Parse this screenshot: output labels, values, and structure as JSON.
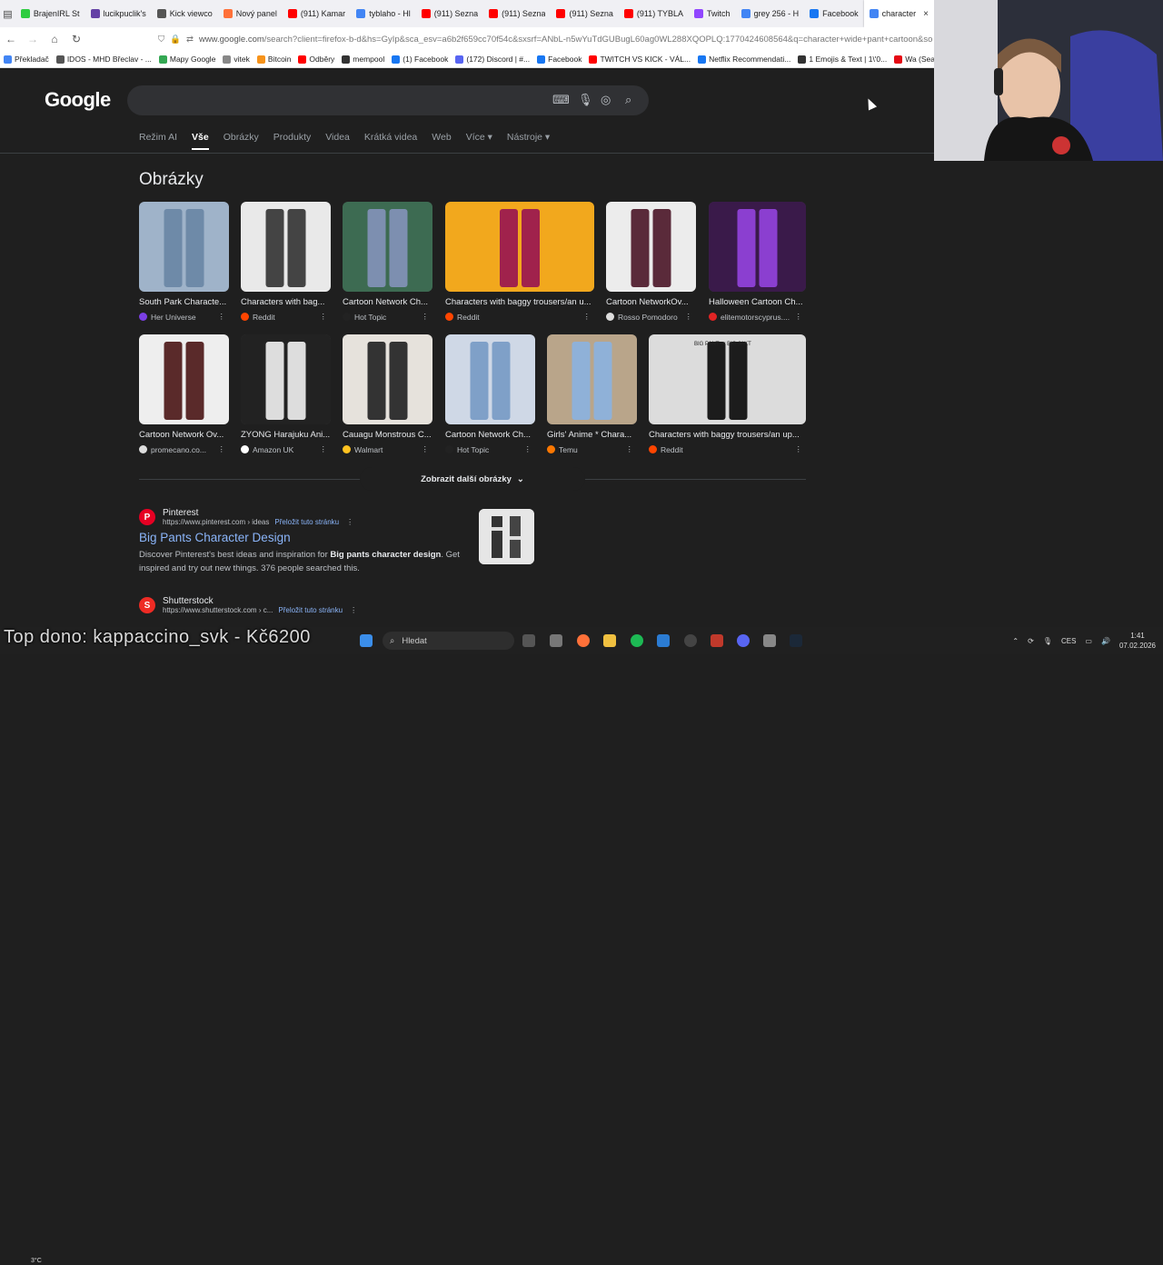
{
  "browser": {
    "tabs": [
      {
        "label": "BrajenIRL St",
        "color": "#2ecc40"
      },
      {
        "label": "lucikpuclik's",
        "color": "#6441a5"
      },
      {
        "label": "Kick viewco",
        "color": "#555555"
      },
      {
        "label": "Nový panel",
        "color": "#ff7139"
      },
      {
        "label": "(911) Kamar",
        "color": "#ff0000"
      },
      {
        "label": "tyblaho - Hl",
        "color": "#4285f4"
      },
      {
        "label": "(911) Sezna",
        "color": "#ff0000"
      },
      {
        "label": "(911) Sezna",
        "color": "#ff0000"
      },
      {
        "label": "(911) Sezna",
        "color": "#ff0000"
      },
      {
        "label": "(911) TYBLA",
        "color": "#ff0000"
      },
      {
        "label": "Twitch",
        "color": "#9146ff"
      },
      {
        "label": "grey 256 - H",
        "color": "#4285f4"
      },
      {
        "label": "Facebook",
        "color": "#1877f2"
      },
      {
        "label": "character",
        "color": "#4285f4",
        "active": true
      }
    ],
    "url_host": "www.google.com",
    "url_rest": "/search?client=firefox-b-d&hs=GyIp&sca_esv=a6b2f659cc70f54c&sxsrf=ANbL-n5wYuTdGUBugL60ag0WL288XQOPLQ:1770424608564&q=character+wide+pant+cartoon&so",
    "bookmarks": [
      {
        "label": "Překladač",
        "color": "#4285f4"
      },
      {
        "label": "IDOS - MHD Břeclav - ...",
        "color": "#555555"
      },
      {
        "label": "Mapy Google",
        "color": "#34a853"
      },
      {
        "label": "vitek",
        "color": "#888888"
      },
      {
        "label": "Bitcoin",
        "color": "#f7931a"
      },
      {
        "label": "Odběry",
        "color": "#ff0000"
      },
      {
        "label": "mempool",
        "color": "#333333"
      },
      {
        "label": "(1) Facebook",
        "color": "#1877f2"
      },
      {
        "label": "(172) Discord | #...",
        "color": "#5865f2"
      },
      {
        "label": "Facebook",
        "color": "#1877f2"
      },
      {
        "label": "TWITCH VS KICK - VÁL...",
        "color": "#ff0000"
      },
      {
        "label": "Netflix Recommendati...",
        "color": "#1877f2"
      },
      {
        "label": "1 Emojis & Text | 1\\'0...",
        "color": "#333333"
      },
      {
        "label": "Wa (Seaso",
        "color": "#e50914"
      }
    ]
  },
  "google": {
    "logo": "Google",
    "tabs": [
      "Režim AI",
      "Vše",
      "Obrázky",
      "Produkty",
      "Videa",
      "Krátká videa",
      "Web",
      "Více ▾",
      "Nástroje ▾"
    ],
    "section_title": "Obrázky",
    "images": [
      {
        "title": "South Park Characte...",
        "source": "Her Universe",
        "src_color": "#7b3fe4"
      },
      {
        "title": "Characters with bag...",
        "source": "Reddit",
        "src_color": "#ff4500"
      },
      {
        "title": "Cartoon Network Ch...",
        "source": "Hot Topic",
        "src_color": "#222222"
      },
      {
        "title": "Characters with baggy trousers/an u...",
        "source": "Reddit",
        "src_color": "#ff4500"
      },
      {
        "title": "Cartoon NetworkOv...",
        "source": "Rosso Pomodoro",
        "src_color": "#dddddd"
      },
      {
        "title": "Halloween Cartoon Ch...",
        "source": "elitemotorscyprus....",
        "src_color": "#e02424"
      },
      {
        "title": "Cartoon Network Ov...",
        "source": "promecano.co...",
        "src_color": "#dddddd"
      },
      {
        "title": "ZYONG Harajuku Ani...",
        "source": "Amazon UK",
        "src_color": "#ffffff"
      },
      {
        "title": "Cauagu Monstrous C...",
        "source": "Walmart",
        "src_color": "#ffc220"
      },
      {
        "title": "Cartoon Network Ch...",
        "source": "Hot Topic",
        "src_color": "#222222"
      },
      {
        "title": "Girls' Anime * Chara...",
        "source": "Temu",
        "src_color": "#fb7701"
      },
      {
        "title": "Characters with baggy trousers/an up...",
        "source": "Reddit",
        "src_color": "#ff4500"
      }
    ],
    "more_images": "Zobrazit další obrázky",
    "thumb_caption": "BIG PANT or BIG JAKT",
    "results": [
      {
        "site": "Pinterest",
        "url": "https://www.pinterest.com › ideas",
        "translate": "Přeložit tuto stránku",
        "title": "Big Pants Character Design",
        "desc_pre": "Discover Pinterest's best ideas and inspiration for ",
        "desc_bold": "Big pants character design",
        "desc_post": ". Get inspired and try out new things. 376 people searched this."
      },
      {
        "site": "Shutterstock",
        "url": "https://www.shutterstock.com › c...",
        "translate": "Přeložit tuto stránku"
      }
    ]
  },
  "taskbar": {
    "search_placeholder": "Hledat",
    "lang": "CES",
    "time": "1:41",
    "date": "07.02.2026",
    "weather": "3°C"
  },
  "overlay_text": "Top dono: kappaccino_svk - Kč6200"
}
